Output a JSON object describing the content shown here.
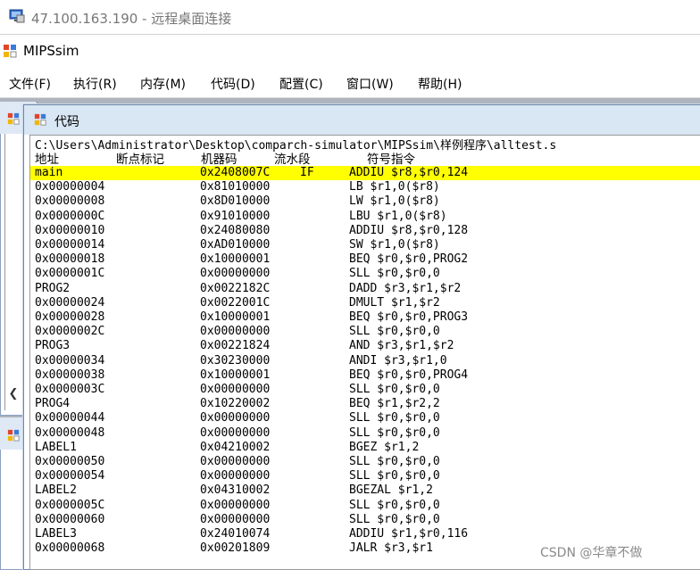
{
  "rdp": {
    "title": "47.100.163.190 - 远程桌面连接"
  },
  "app": {
    "title": "MIPSsim"
  },
  "menu": [
    {
      "label": "文件(F)"
    },
    {
      "label": "执行(R)"
    },
    {
      "label": "内存(M)"
    },
    {
      "label": "代码(D)"
    },
    {
      "label": "配置(C)"
    },
    {
      "label": "窗口(W)"
    },
    {
      "label": "帮助(H)"
    }
  ],
  "code_window": {
    "title": "代码",
    "path": "C:\\Users\\Administrator\\Desktop\\comparch-simulator\\MIPSsim\\样例程序\\alltest.s",
    "columns": {
      "address": "地址",
      "breakpoint": "断点标记",
      "machine_code": "机器码",
      "stage": "流水段",
      "instruction": "符号指令"
    },
    "rows": [
      {
        "addr": "main",
        "code": "0x2408007C",
        "stage": "IF",
        "inst": "ADDIU $r8,$r0,124",
        "highlight": true
      },
      {
        "addr": "0x00000004",
        "code": "0x81010000",
        "stage": "",
        "inst": "LB $r1,0($r8)"
      },
      {
        "addr": "0x00000008",
        "code": "0x8D010000",
        "stage": "",
        "inst": "LW $r1,0($r8)"
      },
      {
        "addr": "0x0000000C",
        "code": "0x91010000",
        "stage": "",
        "inst": "LBU $r1,0($r8)"
      },
      {
        "addr": "0x00000010",
        "code": "0x24080080",
        "stage": "",
        "inst": "ADDIU $r8,$r0,128"
      },
      {
        "addr": "0x00000014",
        "code": "0xAD010000",
        "stage": "",
        "inst": "SW $r1,0($r8)"
      },
      {
        "addr": "0x00000018",
        "code": "0x10000001",
        "stage": "",
        "inst": "BEQ $r0,$r0,PROG2"
      },
      {
        "addr": "0x0000001C",
        "code": "0x00000000",
        "stage": "",
        "inst": "SLL $r0,$r0,0"
      },
      {
        "addr": "PROG2",
        "code": "0x0022182C",
        "stage": "",
        "inst": "DADD $r3,$r1,$r2"
      },
      {
        "addr": "0x00000024",
        "code": "0x0022001C",
        "stage": "",
        "inst": "DMULT $r1,$r2"
      },
      {
        "addr": "0x00000028",
        "code": "0x10000001",
        "stage": "",
        "inst": "BEQ $r0,$r0,PROG3"
      },
      {
        "addr": "0x0000002C",
        "code": "0x00000000",
        "stage": "",
        "inst": "SLL $r0,$r0,0"
      },
      {
        "addr": "PROG3",
        "code": "0x00221824",
        "stage": "",
        "inst": "AND $r3,$r1,$r2"
      },
      {
        "addr": "0x00000034",
        "code": "0x30230000",
        "stage": "",
        "inst": "ANDI $r3,$r1,0"
      },
      {
        "addr": "0x00000038",
        "code": "0x10000001",
        "stage": "",
        "inst": "BEQ $r0,$r0,PROG4"
      },
      {
        "addr": "0x0000003C",
        "code": "0x00000000",
        "stage": "",
        "inst": "SLL $r0,$r0,0"
      },
      {
        "addr": "PROG4",
        "code": "0x10220002",
        "stage": "",
        "inst": "BEQ $r1,$r2,2"
      },
      {
        "addr": "0x00000044",
        "code": "0x00000000",
        "stage": "",
        "inst": "SLL $r0,$r0,0"
      },
      {
        "addr": "0x00000048",
        "code": "0x00000000",
        "stage": "",
        "inst": "SLL $r0,$r0,0"
      },
      {
        "addr": "LABEL1",
        "code": "0x04210002",
        "stage": "",
        "inst": "BGEZ $r1,2"
      },
      {
        "addr": "0x00000050",
        "code": "0x00000000",
        "stage": "",
        "inst": "SLL $r0,$r0,0"
      },
      {
        "addr": "0x00000054",
        "code": "0x00000000",
        "stage": "",
        "inst": "SLL $r0,$r0,0"
      },
      {
        "addr": "LABEL2",
        "code": "0x04310002",
        "stage": "",
        "inst": "BGEZAL $r1,2"
      },
      {
        "addr": "0x0000005C",
        "code": "0x00000000",
        "stage": "",
        "inst": "SLL $r0,$r0,0"
      },
      {
        "addr": "0x00000060",
        "code": "0x00000000",
        "stage": "",
        "inst": "SLL $r0,$r0,0"
      },
      {
        "addr": "LABEL3",
        "code": "0x24010074",
        "stage": "",
        "inst": "ADDIU $r1,$r0,116"
      },
      {
        "addr": "0x00000068",
        "code": "0x00201809",
        "stage": "",
        "inst": "JALR $r3,$r1"
      }
    ]
  },
  "watermark": "CSDN @华章不做",
  "colors": {
    "highlight": "#ffff00",
    "mdi_background": "#aeb4bd",
    "window_header": "#d9e6f4"
  }
}
